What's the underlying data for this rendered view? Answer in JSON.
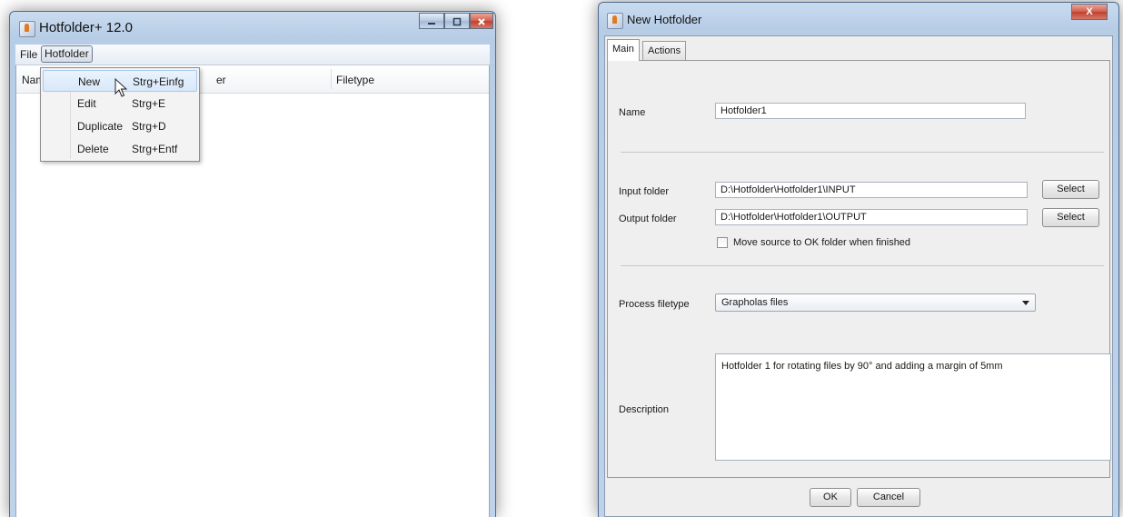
{
  "main_window": {
    "title": "Hotfolder+  12.0",
    "icon": "java-app-icon",
    "controls": {
      "minimize": "minimize-icon",
      "maximize": "maximize-icon",
      "close": "close-icon"
    },
    "menubar": [
      {
        "label": "File"
      },
      {
        "label": "Hotfolder"
      }
    ],
    "table": {
      "columns": [
        "Nam",
        "er",
        "Filetype"
      ]
    },
    "popup_menu": [
      {
        "label": "New",
        "accelerator": "Strg+Einfg",
        "highlighted": true
      },
      {
        "label": "Edit",
        "accelerator": "Strg+E"
      },
      {
        "label": "Duplicate",
        "accelerator": "Strg+D"
      },
      {
        "label": "Delete",
        "accelerator": "Strg+Entf"
      }
    ]
  },
  "dialog": {
    "title": "New Hotfolder",
    "close_glyph": "X",
    "tabs": [
      {
        "label": "Main",
        "active": true
      },
      {
        "label": "Actions",
        "active": false
      }
    ],
    "name": {
      "label": "Name",
      "value": "Hotfolder1"
    },
    "input_folder": {
      "label": "Input folder",
      "value": "D:\\Hotfolder\\Hotfolder1\\INPUT",
      "button": "Select"
    },
    "output_folder": {
      "label": "Output folder",
      "value": "D:\\Hotfolder\\Hotfolder1\\OUTPUT",
      "button": "Select"
    },
    "move_source": {
      "label": "Move source to OK folder when finished",
      "checked": false
    },
    "process_filetype": {
      "label": "Process filetype",
      "value": "Grapholas files"
    },
    "description": {
      "label": "Description",
      "value": "Hotfolder 1 for rotating files by 90° and adding a margin of 5mm"
    },
    "buttons": {
      "ok": "OK",
      "cancel": "Cancel"
    }
  }
}
